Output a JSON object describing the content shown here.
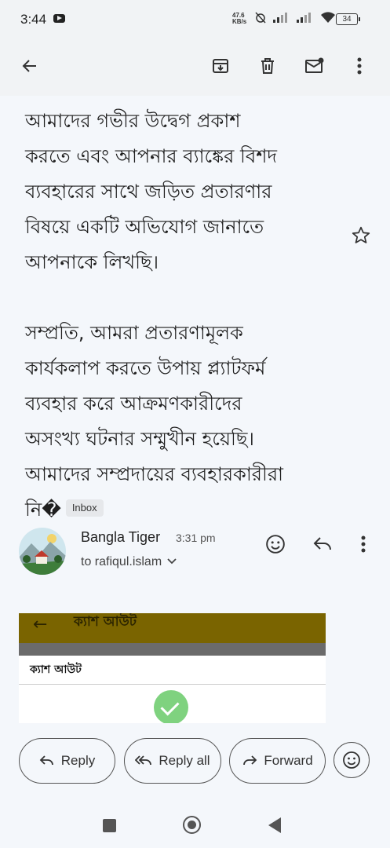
{
  "status_bar": {
    "time": "3:44",
    "net_speed_value": "47.6",
    "net_speed_unit": "KB/s",
    "battery": "34"
  },
  "toolbar": {
    "icons": [
      "back-arrow-icon",
      "archive-icon",
      "delete-icon",
      "mark-unread-icon",
      "more-vert-icon"
    ]
  },
  "email": {
    "paragraphs": [
      "আমাদের গভীর উদ্বেগ প্রকাশ\nকরতে এবং আপনার ব্যাঙ্কের বিশদ\nব্যবহারের সাথে জড়িত প্রতারণার\nবিষয়ে একটি অভিযোগ জানাতে\nআপনাকে লিখছি।",
      "সম্প্রতি, আমরা প্রতারণামূলক\nকার্যকলাপ করতে উপায় প্ল্যাটফর্ম\nব্যবহার করে আক্রমণকারীদের\nঅসংখ্য ঘটনার সম্মুখীন হয়েছি।\nআমাদের সম্প্রদায়ের ব্যবহারকারীরা\nনি�"
    ],
    "label_chip": "Inbox"
  },
  "sender": {
    "name": "Bangla Tiger",
    "time": "3:31 pm",
    "to": "to rafiqul.islam"
  },
  "attachment": {
    "header_title": "ক্যাশ আউট",
    "row_label": "ক্যাশ আউট"
  },
  "actions": {
    "reply": "Reply",
    "reply_all": "Reply all",
    "forward": "Forward"
  }
}
